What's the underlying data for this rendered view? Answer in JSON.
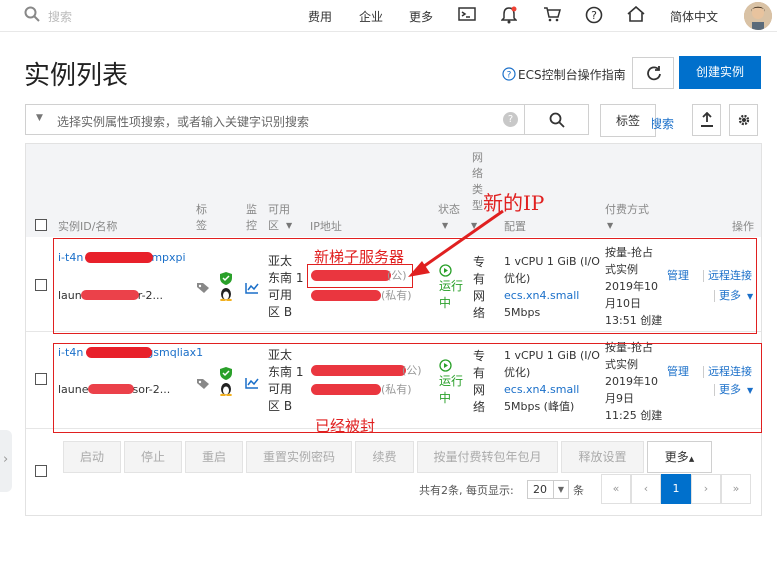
{
  "topbar": {
    "search_placeholder": "搜索",
    "items": [
      "费用",
      "企业",
      "更多"
    ],
    "language": "简体中文"
  },
  "page": {
    "title": "实例列表",
    "guide_link": "ECS控制台操作指南",
    "create_button": "创建实例"
  },
  "filter": {
    "placeholder": "选择实例属性项搜索，或者输入关键字识别搜索",
    "tag_button": "标签",
    "advanced": "搜索"
  },
  "columns": {
    "id_name": "实例ID/名称",
    "tag": "标签",
    "monitor": "监控",
    "zone": "可用区",
    "ip": "IP地址",
    "status": "状态",
    "network_type": "网络类型",
    "config": "配置",
    "billing": "付费方式",
    "actions": "操作"
  },
  "rows": [
    {
      "id_prefix": "i-t4n",
      "id_suffix": "mpxpi",
      "name_prefix": "laun",
      "name_suffix": "r-2...",
      "zone": [
        "亚太",
        "东南 1",
        "可用",
        "区 B"
      ],
      "ip_public_suffix": "(公)",
      "ip_private_suffix": "(私有)",
      "status": [
        "运行",
        "中"
      ],
      "network": [
        "专",
        "有",
        "网",
        "络"
      ],
      "config_line1": "1 vCPU 1 GiB (I/O",
      "config_line2": "优化)",
      "config_type": "ecs.xn4.small",
      "bandwidth": "5Mbps",
      "billing": [
        "按量-抢占",
        "式实例",
        "2019年10",
        "月10日",
        "13:51 创建"
      ],
      "manage": "管理",
      "remote": "远程连接",
      "more": "更多"
    },
    {
      "id_prefix": "i-t4n",
      "id_suffix": "gsmqliax1",
      "name_prefix": "laune",
      "name_suffix": "sor-2...",
      "zone": [
        "亚太",
        "东南 1",
        "可用",
        "区 B"
      ],
      "ip_public_suffix": "(公)",
      "ip_private_suffix": "(私有)",
      "status": [
        "运行",
        "中"
      ],
      "network": [
        "专",
        "有",
        "网",
        "络"
      ],
      "config_line1": "1 vCPU 1 GiB (I/O",
      "config_line2": "优化)",
      "config_type": "ecs.xn4.small",
      "bandwidth": "5Mbps (峰值)",
      "billing": [
        "按量-抢占",
        "式实例",
        "2019年10",
        "月9日",
        "11:25 创建"
      ],
      "manage": "管理",
      "remote": "远程连接",
      "more": "更多"
    }
  ],
  "bulk_actions": [
    "启动",
    "停止",
    "重启",
    "重置实例密码",
    "续费",
    "按量付费转包年包月",
    "释放设置",
    "更多"
  ],
  "pagination": {
    "summary": "共有2条, 每页显示:",
    "page_size": "20",
    "unit": "条",
    "first": "«",
    "prev": "‹",
    "current": "1",
    "next": "›",
    "last": "»"
  },
  "annotations": {
    "new_ip": "新的IP",
    "new_server": "新梯子服务器",
    "blocked": "已经被封"
  },
  "colors": {
    "primary": "#0070cc",
    "link": "#1a6fc9",
    "annotation": "#e02020",
    "running": "#2aa02a"
  }
}
